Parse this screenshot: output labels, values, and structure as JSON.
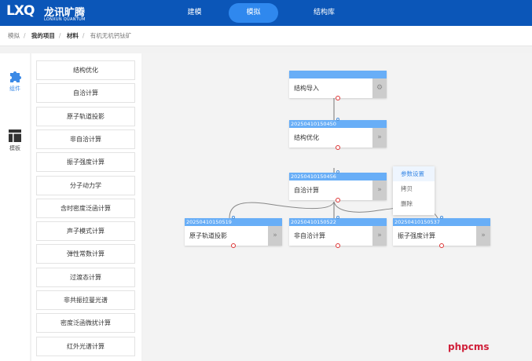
{
  "header": {
    "logo_mark": "LXQ",
    "logo_cn": "龙讯旷腾",
    "logo_en": "LONXUN QUANTUM",
    "nav": [
      "建模",
      "模拟",
      "结构库"
    ],
    "active_nav": "模拟",
    "brand_color": "#0b56b8"
  },
  "breadcrumb": [
    "模拟",
    "我的项目",
    "材料",
    "有机无机钙钛矿"
  ],
  "sidebar": {
    "tabs": [
      {
        "label": "组件",
        "icon": "puzzle-icon",
        "active": true
      },
      {
        "label": "模板",
        "icon": "layout-icon",
        "active": false
      }
    ]
  },
  "components": [
    "结构优化",
    "自洽计算",
    "原子轨道投影",
    "非自洽计算",
    "振子强度计算",
    "分子动力学",
    "含时密度泛函计算",
    "声子模式计算",
    "弹性常数计算",
    "过渡态计算",
    "非共振拉曼光谱",
    "密度泛函微扰计算",
    "红外光谱计算"
  ],
  "nodes": [
    {
      "id": "",
      "label": "结构导入",
      "button": "gear-icon"
    },
    {
      "id": "20250410150450",
      "label": "结构优化",
      "button": "»"
    },
    {
      "id": "20250410150456",
      "label": "自洽计算",
      "button": "»"
    },
    {
      "id": "20250410150519",
      "label": "原子轨道投影",
      "button": "»"
    },
    {
      "id": "20250410150522",
      "label": "非自洽计算",
      "button": "»"
    },
    {
      "id": "20250410150537",
      "label": "振子强度计算",
      "button": "»"
    }
  ],
  "context_menu": [
    "参数设置",
    "拷贝",
    "删除"
  ],
  "watermark": "phpcms"
}
